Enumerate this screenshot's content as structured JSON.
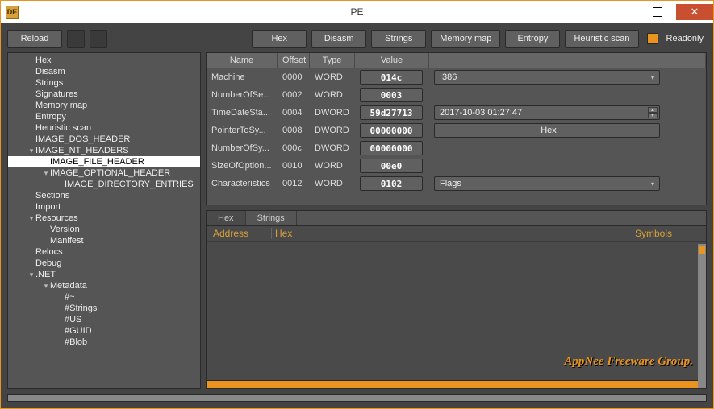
{
  "window": {
    "title": "PE",
    "icon_label": "DE"
  },
  "toolbar": {
    "reload": "Reload",
    "hex": "Hex",
    "disasm": "Disasm",
    "strings": "Strings",
    "memmap": "Memory map",
    "entropy": "Entropy",
    "heuristic": "Heuristic scan",
    "readonly": "Readonly"
  },
  "tree": {
    "items": [
      {
        "label": "Hex",
        "depth": 1
      },
      {
        "label": "Disasm",
        "depth": 1
      },
      {
        "label": "Strings",
        "depth": 1
      },
      {
        "label": "Signatures",
        "depth": 1
      },
      {
        "label": "Memory map",
        "depth": 1
      },
      {
        "label": "Entropy",
        "depth": 1
      },
      {
        "label": "Heuristic scan",
        "depth": 1
      },
      {
        "label": "IMAGE_DOS_HEADER",
        "depth": 1
      },
      {
        "label": "IMAGE_NT_HEADERS",
        "depth": 1,
        "expanded": true
      },
      {
        "label": "IMAGE_FILE_HEADER",
        "depth": 2,
        "selected": true
      },
      {
        "label": "IMAGE_OPTIONAL_HEADER",
        "depth": 2,
        "expanded": true
      },
      {
        "label": "IMAGE_DIRECTORY_ENTRIES",
        "depth": 3
      },
      {
        "label": "Sections",
        "depth": 1
      },
      {
        "label": "Import",
        "depth": 1
      },
      {
        "label": "Resources",
        "depth": 1,
        "expanded": true
      },
      {
        "label": "Version",
        "depth": 2
      },
      {
        "label": "Manifest",
        "depth": 2
      },
      {
        "label": "Relocs",
        "depth": 1
      },
      {
        "label": "Debug",
        "depth": 1
      },
      {
        "label": ".NET",
        "depth": 1,
        "expanded": true
      },
      {
        "label": "Metadata",
        "depth": 2,
        "expanded": true
      },
      {
        "label": "#~",
        "depth": 3
      },
      {
        "label": "#Strings",
        "depth": 3
      },
      {
        "label": "#US",
        "depth": 3
      },
      {
        "label": "#GUID",
        "depth": 3
      },
      {
        "label": "#Blob",
        "depth": 3
      }
    ]
  },
  "table": {
    "headers": {
      "name": "Name",
      "offset": "Offset",
      "type": "Type",
      "value": "Value"
    },
    "rows": [
      {
        "name": "Machine",
        "offset": "0000",
        "type": "WORD",
        "value": "014c",
        "extra_type": "dropdown",
        "extra": "I386"
      },
      {
        "name": "NumberOfSe...",
        "offset": "0002",
        "type": "WORD",
        "value": "0003"
      },
      {
        "name": "TimeDateSta...",
        "offset": "0004",
        "type": "DWORD",
        "value": "59d27713",
        "extra_type": "spinner",
        "extra": "2017-10-03 01:27:47"
      },
      {
        "name": "PointerToSy...",
        "offset": "0008",
        "type": "DWORD",
        "value": "00000000",
        "extra_type": "button",
        "extra": "Hex"
      },
      {
        "name": "NumberOfSy...",
        "offset": "000c",
        "type": "DWORD",
        "value": "00000000"
      },
      {
        "name": "SizeOfOption...",
        "offset": "0010",
        "type": "WORD",
        "value": "00e0"
      },
      {
        "name": "Characteristics",
        "offset": "0012",
        "type": "WORD",
        "value": "0102",
        "extra_type": "dropdown",
        "extra": "Flags"
      }
    ]
  },
  "hex": {
    "tabs": {
      "hex": "Hex",
      "strings": "Strings"
    },
    "headers": {
      "addr": "Address",
      "hex": "Hex",
      "sym": "Symbols"
    },
    "watermark": "AppNee Freeware Group."
  }
}
